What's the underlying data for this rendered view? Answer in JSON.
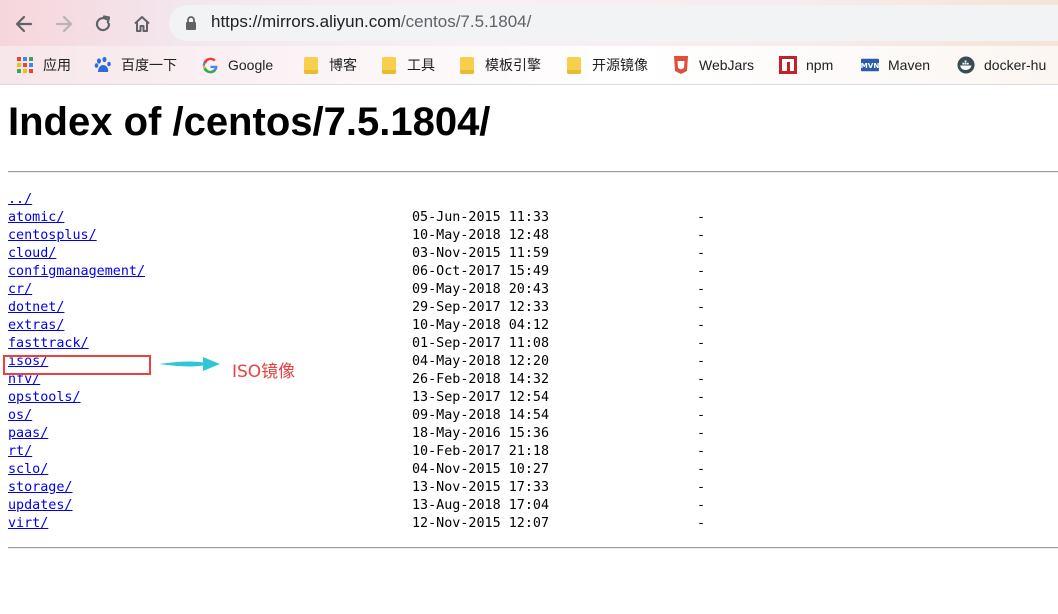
{
  "browser": {
    "url_host": "https://mirrors.aliyun.com",
    "url_path": "/centos/7.5.1804/",
    "nav": {
      "back": "back-arrow-icon",
      "forward": "forward-arrow-icon",
      "reload": "reload-icon",
      "home": "home-icon"
    }
  },
  "bookmarks": [
    {
      "label": "应用",
      "icon": "apps-grid-icon"
    },
    {
      "label": "百度一下",
      "icon": "baidu-paw-icon"
    },
    {
      "label": "Google",
      "icon": "google-g-icon"
    },
    {
      "label": "博客",
      "icon": "folder-icon"
    },
    {
      "label": "工具",
      "icon": "folder-icon"
    },
    {
      "label": "模板引擎",
      "icon": "folder-icon"
    },
    {
      "label": "开源镜像",
      "icon": "folder-icon"
    },
    {
      "label": "WebJars",
      "icon": "webjars-icon"
    },
    {
      "label": "npm",
      "icon": "npm-icon"
    },
    {
      "label": "Maven",
      "icon": "maven-icon"
    },
    {
      "label": "docker-hu",
      "icon": "docker-icon"
    }
  ],
  "page": {
    "title": "Index of /centos/7.5.1804/",
    "parent_link": "../",
    "entries": [
      {
        "name": "atomic/",
        "date": "05-Jun-2015 11:33",
        "size": "-"
      },
      {
        "name": "centosplus/",
        "date": "10-May-2018 12:48",
        "size": "-"
      },
      {
        "name": "cloud/",
        "date": "03-Nov-2015 11:59",
        "size": "-"
      },
      {
        "name": "configmanagement/",
        "date": "06-Oct-2017 15:49",
        "size": "-"
      },
      {
        "name": "cr/",
        "date": "09-May-2018 20:43",
        "size": "-"
      },
      {
        "name": "dotnet/",
        "date": "29-Sep-2017 12:33",
        "size": "-"
      },
      {
        "name": "extras/",
        "date": "10-May-2018 04:12",
        "size": "-"
      },
      {
        "name": "fasttrack/",
        "date": "01-Sep-2017 11:08",
        "size": "-"
      },
      {
        "name": "isos/",
        "date": "04-May-2018 12:20",
        "size": "-"
      },
      {
        "name": "nfv/",
        "date": "26-Feb-2018 14:32",
        "size": "-"
      },
      {
        "name": "opstools/",
        "date": "13-Sep-2017 12:54",
        "size": "-"
      },
      {
        "name": "os/",
        "date": "09-May-2018 14:54",
        "size": "-"
      },
      {
        "name": "paas/",
        "date": "18-May-2016 15:36",
        "size": "-"
      },
      {
        "name": "rt/",
        "date": "10-Feb-2017 21:18",
        "size": "-"
      },
      {
        "name": "sclo/",
        "date": "04-Nov-2015 10:27",
        "size": "-"
      },
      {
        "name": "storage/",
        "date": "13-Nov-2015 17:33",
        "size": "-"
      },
      {
        "name": "updates/",
        "date": "13-Aug-2018 17:04",
        "size": "-"
      },
      {
        "name": "virt/",
        "date": "12-Nov-2015 12:07",
        "size": "-"
      }
    ]
  },
  "annotation": {
    "text": "ISO镜像",
    "color": "#e8413f",
    "arrow_color": "#2fc7d6"
  }
}
